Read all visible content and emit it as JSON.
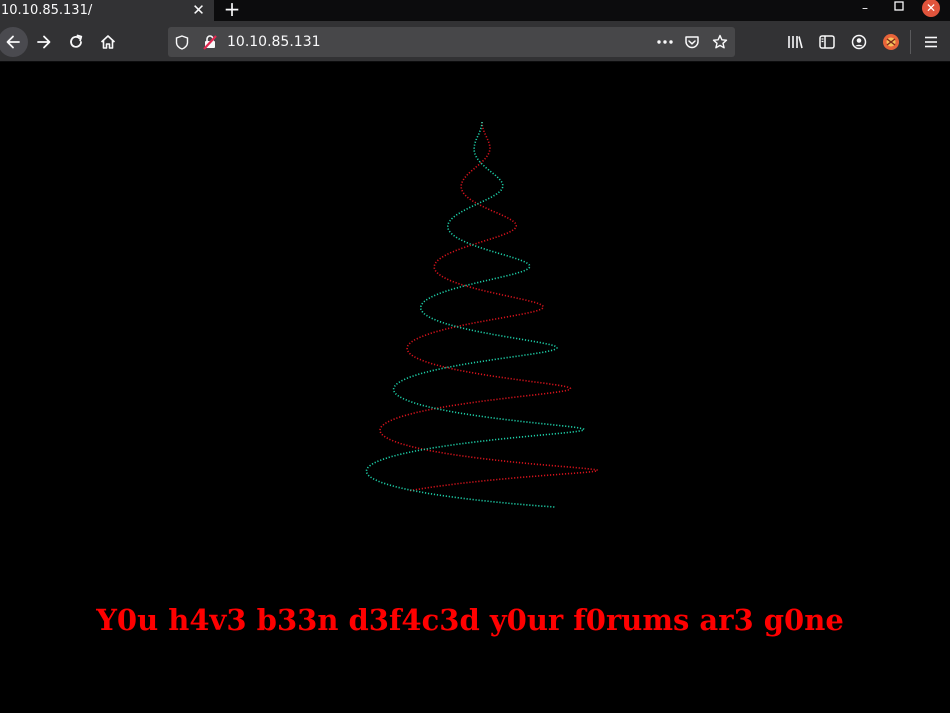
{
  "browser": {
    "tab": {
      "title": "10.10.85.131/"
    },
    "url": "10.10.85.131",
    "page_actions_icon": "more-dots-icon",
    "colors": {
      "frame": "#0c0c0d",
      "toolbar": "#323234",
      "urlbar": "#474749",
      "close": "#e0543c"
    }
  },
  "page": {
    "banner": "Y0u h4v3 b33n d3f4c3d y0ur f0rums ar3 g0ne",
    "colors": {
      "background": "#000000",
      "text": "#ff0000",
      "ribbon_red": "#e0141e",
      "ribbon_teal": "#1fd9b0"
    }
  }
}
